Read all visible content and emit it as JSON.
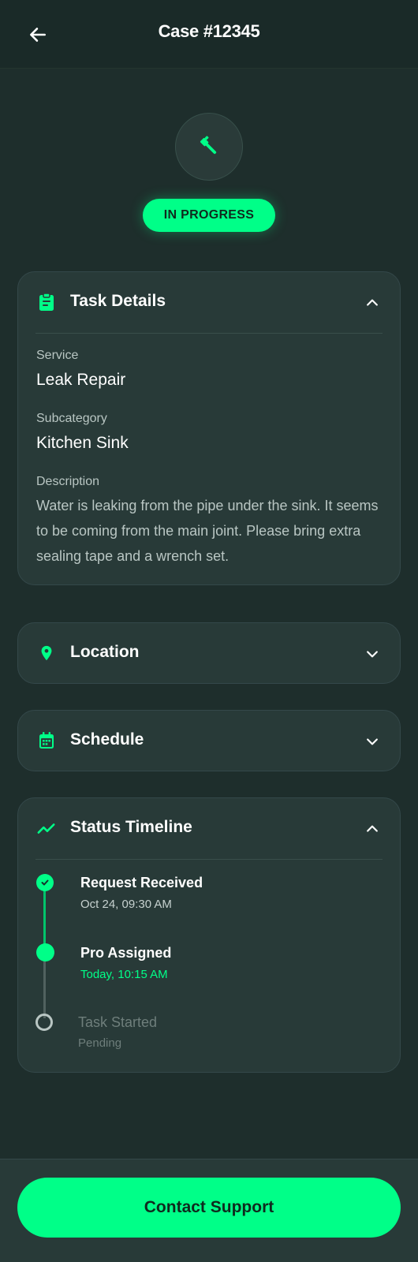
{
  "header": {
    "title": "Case #12345",
    "back_icon": "arrow-left-icon"
  },
  "hero": {
    "icon": "wrench-icon",
    "status": "IN PROGRESS"
  },
  "colors": {
    "accent": "#00ff88",
    "background": "#1e2e2c",
    "card": "#283a38",
    "muted": "#b9c6c3"
  },
  "task_details": {
    "title": "Task Details",
    "icon": "clipboard-icon",
    "service_label": "Service",
    "service_value": "Leak Repair",
    "subcategory_label": "Subcategory",
    "subcategory_value": "Kitchen Sink",
    "description_label": "Description",
    "description_value": "Water is leaking from the pipe under the sink. It seems to be coming from the main joint. Please bring extra sealing tape and a wrench set."
  },
  "location": {
    "title": "Location",
    "icon": "map-pin-icon"
  },
  "schedule": {
    "title": "Schedule",
    "icon": "calendar-icon"
  },
  "timeline": {
    "title": "Status Timeline",
    "icon": "trending-up-icon",
    "steps": [
      {
        "title": "Request Received",
        "time": "Oct 24, 09:30 AM",
        "state": "done"
      },
      {
        "title": "Pro Assigned",
        "time": "Today, 10:15 AM",
        "state": "current"
      },
      {
        "title": "Task Started",
        "time": "Pending",
        "state": "pending"
      }
    ]
  },
  "footer": {
    "cta_label": "Contact Support"
  }
}
